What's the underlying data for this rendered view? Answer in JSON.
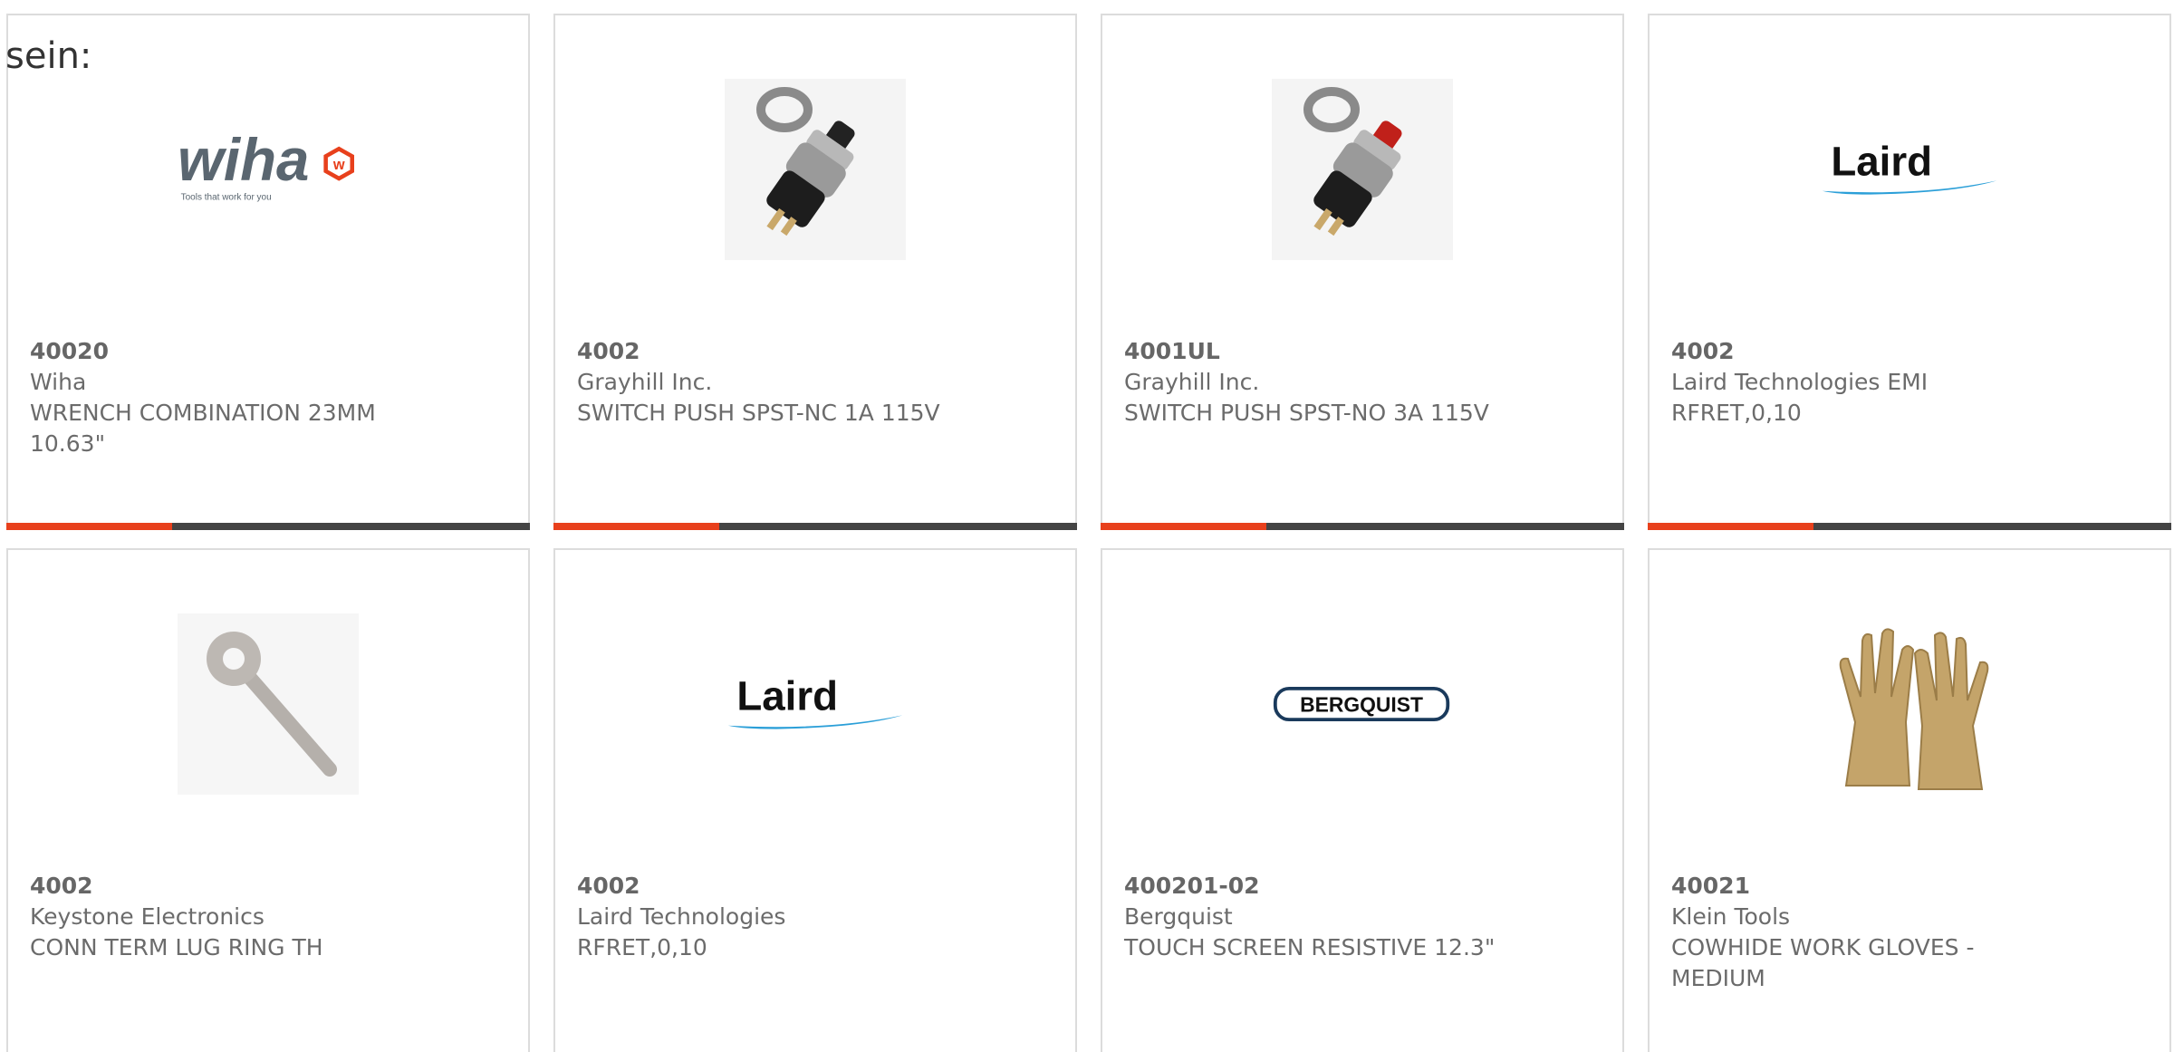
{
  "intro_text": "sein:",
  "colors": {
    "accent": "#e8401c",
    "bar": "#444444",
    "border": "#dcdcdc",
    "text": "#6b6b6b"
  },
  "products": [
    {
      "part_number": "40020",
      "manufacturer": "Wiha",
      "description": "WRENCH COMBINATION 23MM 10.63\"",
      "image": "wiha-logo",
      "logo_text": "wiha",
      "logo_tagline": "Tools that work for you"
    },
    {
      "part_number": "4002",
      "manufacturer": "Grayhill Inc.",
      "description": "SWITCH PUSH SPST-NC 1A 115V",
      "image": "pushbutton-switch-black"
    },
    {
      "part_number": "4001UL",
      "manufacturer": "Grayhill Inc.",
      "description": "SWITCH PUSH SPST-NO 3A 115V",
      "image": "pushbutton-switch-red"
    },
    {
      "part_number": "4002",
      "manufacturer": "Laird Technologies EMI",
      "description": "RFRET,0,10",
      "image": "laird-logo",
      "logo_text": "Laird"
    },
    {
      "part_number": "4002",
      "manufacturer": "Keystone Electronics",
      "description": "CONN TERM LUG RING TH",
      "image": "ring-lug-terminal"
    },
    {
      "part_number": "4002",
      "manufacturer": "Laird Technologies",
      "description": "RFRET,0,10",
      "image": "laird-logo",
      "logo_text": "Laird"
    },
    {
      "part_number": "400201-02",
      "manufacturer": "Bergquist",
      "description": "TOUCH SCREEN RESISTIVE 12.3\"",
      "image": "bergquist-logo",
      "logo_text": "BERGQUIST"
    },
    {
      "part_number": "40021",
      "manufacturer": "Klein Tools",
      "description": "COWHIDE WORK GLOVES - MEDIUM",
      "image": "work-gloves"
    }
  ]
}
